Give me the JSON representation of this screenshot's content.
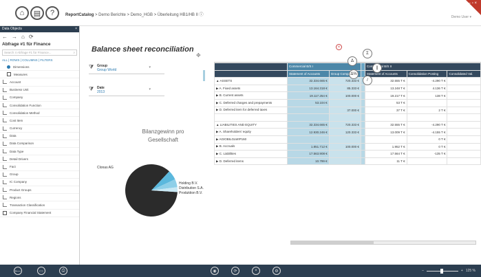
{
  "topbar": {
    "home_label": "home-icon",
    "catalog_label": "catalog-icon",
    "help_label": "?",
    "breadcrumb_root": "ReportCatalog",
    "breadcrumb_rest": "> Demo Berichte > Demo_HGB > Überleitung HB1/HB II ⓘ",
    "user": "Demo User ▾"
  },
  "sidebar": {
    "header": "Data Objects",
    "header_close": "×",
    "title": "Abfrage #1 für Finance",
    "search_placeholder": "Search 4 Abfrage #1 für Finance...",
    "filter_bar": "ALL | ROWS | COLUMNS | FILTERS",
    "items": [
      {
        "label": "Dimensions",
        "kind": "dot",
        "indent": true
      },
      {
        "label": "Measures",
        "kind": "box",
        "indent": true
      },
      {
        "label": "Account",
        "kind": "ic"
      },
      {
        "label": "Business Unit",
        "kind": "ic"
      },
      {
        "label": "Company",
        "kind": "ic"
      },
      {
        "label": "Consolidation Function",
        "kind": "ic"
      },
      {
        "label": "Consolidation Method",
        "kind": "ic"
      },
      {
        "label": "Cost Item",
        "kind": "ic"
      },
      {
        "label": "Currency",
        "kind": "ic"
      },
      {
        "label": "Data",
        "kind": "ic"
      },
      {
        "label": "Data Comparison",
        "kind": "ic"
      },
      {
        "label": "Data Type",
        "kind": "ic"
      },
      {
        "label": "Detail Drivers",
        "kind": "ic"
      },
      {
        "label": "Fact",
        "kind": "ic"
      },
      {
        "label": "Group",
        "kind": "ic"
      },
      {
        "label": "IC Company",
        "kind": "ic"
      },
      {
        "label": "Product Groups",
        "kind": "ic"
      },
      {
        "label": "Regions",
        "kind": "ic"
      },
      {
        "label": "Transaction Classification",
        "kind": "ic"
      },
      {
        "label": "Company Financial Statement",
        "kind": "box"
      }
    ]
  },
  "report": {
    "title": "Balance sheet reconciliation",
    "filters": [
      {
        "label": "Group",
        "value": "Group World"
      },
      {
        "label": "Date",
        "value": "2013"
      }
    ],
    "pie_title_line1": "Bilanzgewinn pro",
    "pie_title_line2": "Gesellschaft",
    "pie_labels": [
      "Clonas AG",
      "Holding B.V.",
      "Distribution S.A.",
      "Produktion B.V."
    ]
  },
  "chart_data": {
    "type": "pie",
    "title": "Bilanzgewinn pro Gesellschaft",
    "slices": [
      {
        "name": "Clonas AG",
        "value": 86,
        "color": "#2b2b2b"
      },
      {
        "name": "Holding B.V.",
        "value": 6,
        "color": "#5bb8dd"
      },
      {
        "name": "Distribution S.A.",
        "value": 5,
        "color": "#8ecfe8"
      },
      {
        "name": "Produktion B.V.",
        "value": 3,
        "color": "#c8e8f4"
      }
    ]
  },
  "pivot": {
    "top_headers": [
      "",
      "Commercial B/S I",
      "",
      "",
      "Commercial B/S II",
      "",
      "",
      "",
      ""
    ],
    "sub_headers": [
      "",
      "Statement of Accounts",
      "Group Company",
      "",
      "Statement of Accounts",
      "Consolidation Posting",
      "Consolidated Val."
    ],
    "rows": [
      {
        "label": "▲ ASSETS",
        "v": [
          "32.334.665 €",
          "720.333 €",
          "",
          "32.555 T €",
          "-4.290 T €",
          ""
        ]
      },
      {
        "label": "  ▶ A. Fixed assets",
        "v": [
          "13.164.318 €",
          "85.333 €",
          "",
          "13.248 T €",
          "4.136 T €",
          ""
        ]
      },
      {
        "label": "  ▶ B. Current assets",
        "v": [
          "19.117.254 €",
          "100.000 €",
          "",
          "19.217 T €",
          "138 T €",
          ""
        ]
      },
      {
        "label": "  ▶ C. Deferred charges and prepayments",
        "v": [
          "53.104 €",
          "",
          "",
          "53 T €",
          "",
          ""
        ]
      },
      {
        "label": "  ▶ D. Deferred item for deferred taxes",
        "v": [
          "",
          "37.000 €",
          "",
          "37 T €",
          "2 T €",
          ""
        ]
      },
      {
        "label": "",
        "v": [
          "",
          "",
          "",
          "",
          "",
          ""
        ]
      },
      {
        "label": "▲ LIABILITIES AND EQUITY",
        "v": [
          "32.334.665 €",
          "720.333 €",
          "",
          "32.555 T €",
          "-4.290 T €",
          ""
        ]
      },
      {
        "label": "  ▶ A. Shareholders' equity",
        "v": [
          "12.930.246 €",
          "120.333 €",
          "",
          "13.009 T €",
          "-4.155 T €",
          ""
        ]
      },
      {
        "label": "  ▶ AGIOBILGLWIP160",
        "v": [
          "",
          "",
          "",
          "",
          "0 T €",
          ""
        ]
      },
      {
        "label": "  ▶ B. Accruals",
        "v": [
          "1.851.712 €",
          "100.000 €",
          "",
          "1.952 T €",
          "0 T €",
          ""
        ]
      },
      {
        "label": "  ▶ C. Liabilities",
        "v": [
          "17.563.908 €",
          "",
          "",
          "17.564 T €",
          "-135 T €",
          ""
        ]
      },
      {
        "label": "  ▶ D. Deferred items",
        "v": [
          "10.799 €",
          "",
          "",
          "11 T €",
          "",
          ""
        ]
      }
    ]
  },
  "tools": {
    "delta": "Δ",
    "sigma": "Σ",
    "pct": "Δ%",
    "pause": "||",
    "slash": "/"
  },
  "bottombar": {
    "zoom": "125 %"
  }
}
